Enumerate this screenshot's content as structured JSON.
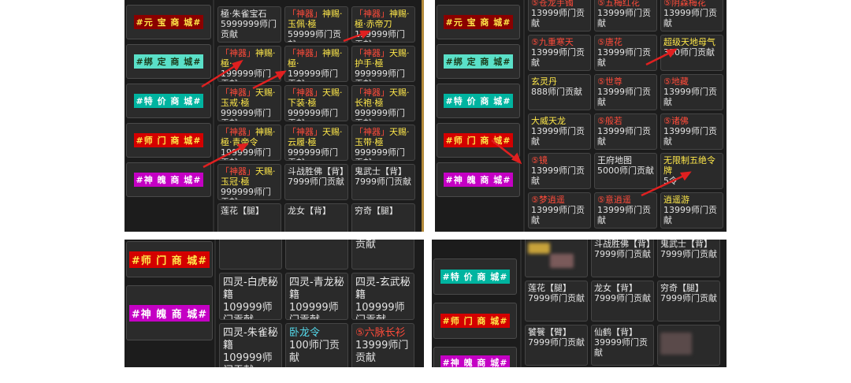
{
  "colors": {
    "yellow": "#ffe84a",
    "red": "#ff4b3a",
    "green": "#8cf05a",
    "cyan": "#55dcee",
    "white": "#e8e8e8"
  },
  "tabs": {
    "yuanbao": "#元 宝 商 城#",
    "bangding": "#绑 定 商 城#",
    "tejia": "#特 价 商 城#",
    "shimen": "#师 门 商 城#",
    "shenpo": "#神 魄 商 城#"
  },
  "p1_cells": [
    {
      "name": "極·朱雀宝石",
      "price": "5999999师门贡献"
    },
    {
      "name": "「神器」神赐·玉佩·極",
      "price": "59999师门贡献"
    },
    {
      "name": "「神器」神赐·極·赤帝刀",
      "price": "199999师门贡献"
    },
    {
      "name": "「神器」神赐·極·",
      "price": "199999师门贡献"
    },
    {
      "name": "「神器」神赐·極·",
      "price": "199999师门贡献"
    },
    {
      "name": "「神器」天赐·护手·極",
      "price": "999999师门贡献"
    },
    {
      "name": "「神器」天赐·玉戒·極",
      "price": "999999师门贡献"
    },
    {
      "name": "「神器」天赐·下装·極",
      "price": "999999师门贡献"
    },
    {
      "name": "「神器」天赐·长袍·極",
      "price": "999999师门贡献"
    },
    {
      "name": "「神器」神赐·極·青帝令",
      "price": "199999师门贡献"
    },
    {
      "name": "「神器」天赐·云履·極",
      "price": "999999师门贡献"
    },
    {
      "name": "「神器」天赐·玉带·極",
      "price": "999999师门贡献"
    },
    {
      "name": "「神器」天赐·玉冠·極",
      "price": "999999师门贡献"
    },
    {
      "name": "斗战胜佛【背】",
      "price": "7999师门贡献"
    },
    {
      "name": "鬼武士【背】",
      "price": "7999师门贡献"
    },
    {
      "name": "莲花【腿】",
      "price": ""
    },
    {
      "name": "龙女【背】",
      "price": ""
    },
    {
      "name": "穷奇【腿】",
      "price": ""
    }
  ],
  "p2_cells": [
    {
      "name": "⑤苍龙手镯",
      "price": "13999师门贡献"
    },
    {
      "name": "⑤五梅红花",
      "price": "13999师门贡献"
    },
    {
      "name": "⑤阴森梅花",
      "price": "13999师门贡献"
    },
    {
      "name": "⑤九重寒天",
      "price": "13999师门贡献"
    },
    {
      "name": "⑤唐花",
      "price": "13999师门贡献"
    },
    {
      "name": "超级天地母气",
      "price": "350师门贡献"
    },
    {
      "name": "玄灵丹",
      "price": "888师门贡献"
    },
    {
      "name": "⑤世尊",
      "price": "13999师门贡献"
    },
    {
      "name": "⑤地藏",
      "price": "13999师门贡献"
    },
    {
      "name": "大威天龙",
      "price": "13999师门贡献"
    },
    {
      "name": "⑤般若",
      "price": "13999师门贡献"
    },
    {
      "name": "⑤诸佛",
      "price": "13999师门贡献"
    },
    {
      "name": "⑤镜",
      "price": "13999师门贡献"
    },
    {
      "name": "王府地图",
      "price": "5000师门贡献"
    },
    {
      "name": "无限制五绝令牌",
      "price": "5令"
    },
    {
      "name": "⑤梦逍遥",
      "price": "13999师门贡献"
    },
    {
      "name": "⑤意逍遥",
      "price": "13999师门贡献"
    },
    {
      "name": "逍遥游",
      "price": "13999师门贡献"
    }
  ],
  "p3_cells": [
    {
      "name": "",
      "price": "献"
    },
    {
      "name": "",
      "price": "献"
    },
    {
      "name": "",
      "price": "13999师门贡献"
    },
    {
      "name": "四灵-白虎秘籍",
      "price": "109999师门贡献"
    },
    {
      "name": "四灵-青龙秘籍",
      "price": "109999师门贡献"
    },
    {
      "name": "四灵-玄武秘籍",
      "price": "109999师门贡献"
    },
    {
      "name": "四灵-朱雀秘籍",
      "price": "109999师门贡献"
    },
    {
      "name": "卧龙令",
      "price": "100师门贡献"
    },
    {
      "name": "⑤六脉长衫",
      "price": "13999师门贡献"
    }
  ],
  "p4_cells": [
    {
      "name": "",
      "price": ""
    },
    {
      "name": "斗战胜佛【背】",
      "price": "7999师门贡献"
    },
    {
      "name": "鬼武士【背】",
      "price": "7999师门贡献"
    },
    {
      "name": "莲花【腿】",
      "price": "7999师门贡献"
    },
    {
      "name": "龙女【背】",
      "price": "7999师门贡献"
    },
    {
      "name": "穷奇【腿】",
      "price": "7999师门贡献"
    },
    {
      "name": "饕餮【臂】",
      "price": "7999师门贡献"
    },
    {
      "name": "仙鹤【背】",
      "price": "39999师门贡献"
    },
    {
      "name": "",
      "price": ""
    }
  ]
}
